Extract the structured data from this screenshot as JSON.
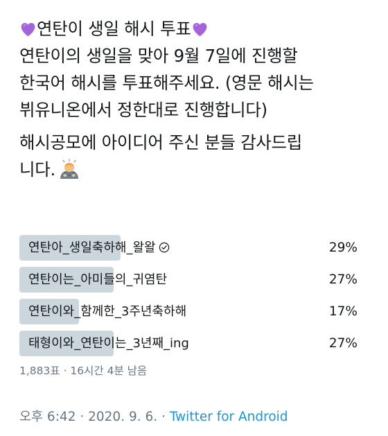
{
  "tweet": {
    "title": "연탄이 생일 해시 투표",
    "line1": "연탄이의 생일을 맞아 9월 7일에 진행할",
    "line2": "한국어 해시를 투표해주세요. (영문 해시는",
    "line3": "뷔유니온에서 정한대로 진행합니다)",
    "line4": "해시공모에 아이디어 주신 분들 감사드립",
    "line5": "니다."
  },
  "poll": {
    "options": [
      {
        "label": "연탄아_생일축하해_왈왈",
        "percent_text": "29%",
        "percent": 29,
        "selected": true
      },
      {
        "label": "연탄이는_아미들의_귀염탄",
        "percent_text": "27%",
        "percent": 27,
        "selected": false
      },
      {
        "label": "연탄이와_함께한_3주년축하해",
        "percent_text": "17%",
        "percent": 17,
        "selected": false
      },
      {
        "label": "태형이와_연탄이는_3년째_ing",
        "percent_text": "27%",
        "percent": 27,
        "selected": false
      }
    ],
    "votes": "1,883표",
    "time_left": "16시간 4분 남음"
  },
  "footer": {
    "time": "오후 6:42",
    "date": "2020. 9. 6.",
    "source": "Twitter for Android"
  },
  "colors": {
    "bar": "#ccd6dd",
    "meta_text": "#657786",
    "link": "#1b95e0",
    "heart": "#a463d8"
  },
  "icons": {
    "heart": "purple-heart-icon",
    "bow": "person-bowing-icon",
    "check": "check-circle-icon"
  }
}
